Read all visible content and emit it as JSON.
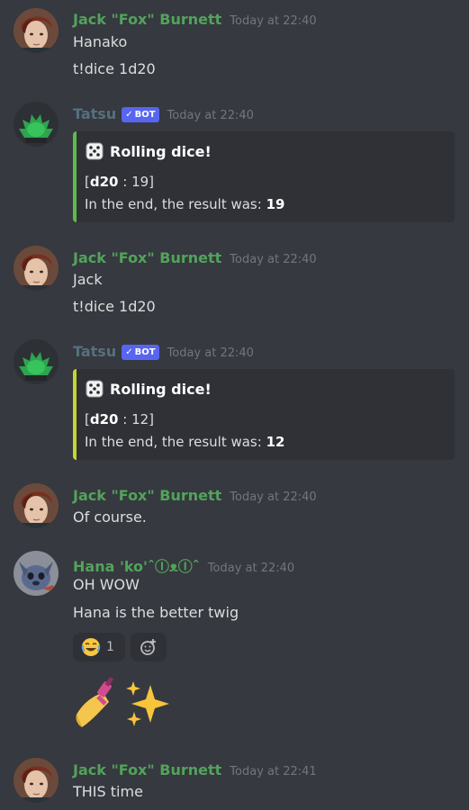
{
  "messages": {
    "m1": {
      "author": "Jack \"Fox\" Burnett",
      "time": "Today at 22:40",
      "lines": [
        "Hanako",
        "t!dice 1d20"
      ]
    },
    "m2": {
      "author": "Tatsu",
      "bot_tag": "BOT",
      "time": "Today at 22:40",
      "embed": {
        "title": "Rolling dice!",
        "roll_open": "[",
        "roll_die": "d20",
        "roll_rest": " : 19]",
        "result_prefix": "In the end, the result was: ",
        "result_value": "19",
        "accent": "#5dbb4a"
      }
    },
    "m3": {
      "author": "Jack \"Fox\" Burnett",
      "time": "Today at 22:40",
      "lines": [
        "Jack",
        "t!dice 1d20"
      ]
    },
    "m4": {
      "author": "Tatsu",
      "bot_tag": "BOT",
      "time": "Today at 22:40",
      "embed": {
        "title": "Rolling dice!",
        "roll_open": "[",
        "roll_die": "d20",
        "roll_rest": " : 12]",
        "result_prefix": "In the end, the result was: ",
        "result_value": "12",
        "accent": "#c7d532"
      }
    },
    "m5": {
      "author": "Jack \"Fox\" Burnett",
      "time": "Today at 22:40",
      "lines": [
        "Of course."
      ]
    },
    "m6": {
      "author": "Hana 'ko'ˆⒾᴥⒾˆ",
      "time": "Today at 22:40",
      "lines": [
        "OH WOW",
        "Hana is the better twig"
      ],
      "reaction_count": "1",
      "reaction_icon": "joy-emoji",
      "add_reaction_icon": "add-reaction-icon",
      "big_emojis": [
        "nail-polish-emoji",
        "sparkles-emoji"
      ]
    },
    "m7": {
      "author": "Jack \"Fox\" Burnett",
      "time": "Today at 22:41",
      "lines": [
        "THIS time"
      ]
    }
  },
  "colors": {
    "background": "#36393f",
    "embed_background": "#2f3136",
    "username_green": "#52a35b",
    "username_tatsu": "#56707d",
    "bot_tag": "#5865f2",
    "timestamp": "#72767d"
  }
}
